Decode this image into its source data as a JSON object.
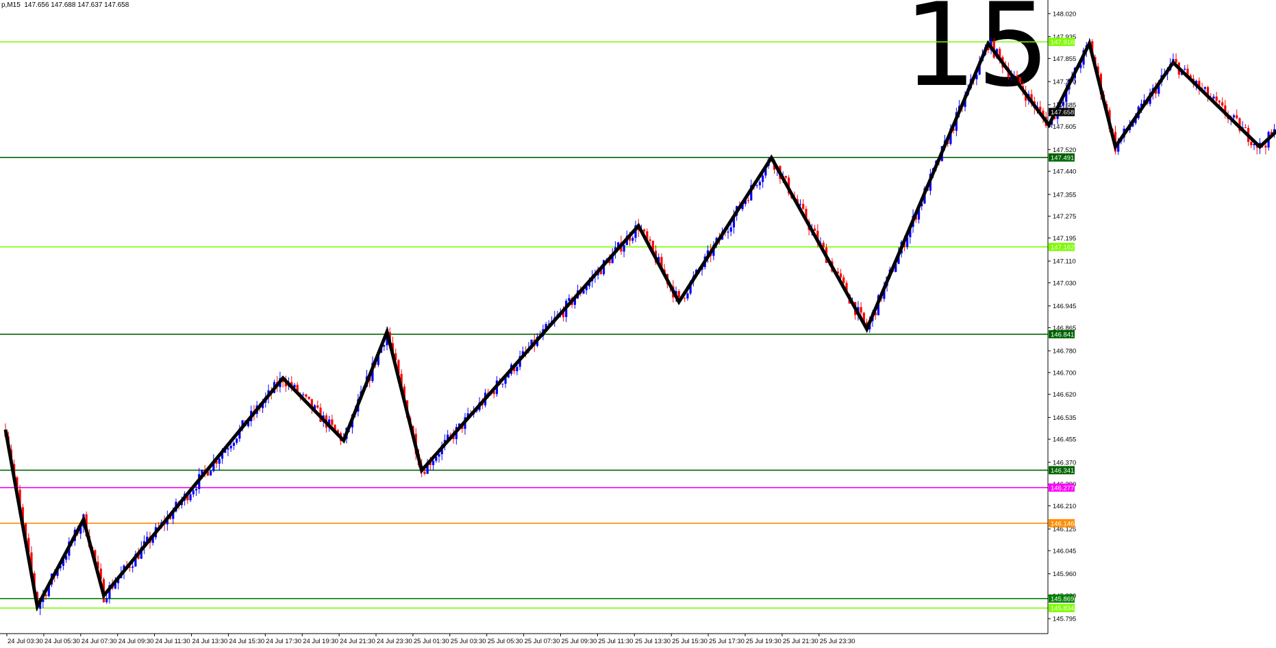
{
  "header": {
    "symbol": "p,M15",
    "ohlc": "147.656 147.688 147.637 147.658"
  },
  "overlay": {
    "number": "15"
  },
  "chart_data": {
    "type": "candlestick",
    "timeframe": "M15",
    "ylim": [
      145.74,
      148.07
    ],
    "price_labels": [
      "148.020",
      "147.935",
      "147.855",
      "147.770",
      "147.685",
      "147.605",
      "147.520",
      "147.440",
      "147.355",
      "147.275",
      "147.195",
      "147.110",
      "147.030",
      "146.945",
      "146.865",
      "146.780",
      "146.700",
      "146.620",
      "146.535",
      "146.455",
      "146.370",
      "146.290",
      "146.210",
      "146.125",
      "146.045",
      "145.960",
      "145.880",
      "145.795"
    ],
    "time_labels": [
      "24 Jul 03:30",
      "24 Jul 05:30",
      "24 Jul 07:30",
      "24 Jul 09:30",
      "24 Jul 11:30",
      "24 Jul 13:30",
      "24 Jul 15:30",
      "24 Jul 17:30",
      "24 Jul 19:30",
      "24 Jul 21:30",
      "24 Jul 23:30",
      "25 Jul 01:30",
      "25 Jul 03:30",
      "25 Jul 05:30",
      "25 Jul 07:30",
      "25 Jul 09:30",
      "25 Jul 11:30",
      "25 Jul 13:30",
      "25 Jul 15:30",
      "25 Jul 17:30",
      "25 Jul 19:30",
      "25 Jul 21:30",
      "25 Jul 23:30"
    ],
    "current_price": "147.658",
    "levels": [
      {
        "price": 147.916,
        "label": "147.916",
        "color": "#7CFC00"
      },
      {
        "price": 147.491,
        "label": "147.491",
        "color": "#006400"
      },
      {
        "price": 147.162,
        "label": "147.162",
        "color": "#7CFC00"
      },
      {
        "price": 146.841,
        "label": "146.841",
        "color": "#006400"
      },
      {
        "price": 146.341,
        "label": "146.341",
        "color": "#006400"
      },
      {
        "price": 146.277,
        "label": "146.277",
        "color": "#FF00FF"
      },
      {
        "price": 146.146,
        "label": "146.146",
        "color": "#FF8C00"
      },
      {
        "price": 145.869,
        "label": "145.869",
        "color": "#008000"
      },
      {
        "price": 145.834,
        "label": "145.834",
        "color": "#7CFC00"
      }
    ],
    "zigzag": [
      {
        "t": 0,
        "p": 146.49
      },
      {
        "t": 11,
        "p": 145.84
      },
      {
        "t": 27,
        "p": 146.16
      },
      {
        "t": 34,
        "p": 145.88
      },
      {
        "t": 96,
        "p": 146.68
      },
      {
        "t": 117,
        "p": 146.45
      },
      {
        "t": 132,
        "p": 146.85
      },
      {
        "t": 144,
        "p": 146.34
      },
      {
        "t": 219,
        "p": 147.24
      },
      {
        "t": 233,
        "p": 146.96
      },
      {
        "t": 265,
        "p": 147.49
      },
      {
        "t": 298,
        "p": 146.86
      },
      {
        "t": 340,
        "p": 147.91
      },
      {
        "t": 361,
        "p": 147.61
      },
      {
        "t": 375,
        "p": 147.91
      },
      {
        "t": 384,
        "p": 147.53
      },
      {
        "t": 404,
        "p": 147.84
      },
      {
        "t": 434,
        "p": 147.53
      },
      {
        "t": 444,
        "p": 147.63
      }
    ],
    "colors": {
      "bull": "#0000FF",
      "bear": "#FF0000",
      "zigzag": "#000000",
      "axis": "#000000",
      "background": "#FFFFFF"
    }
  }
}
